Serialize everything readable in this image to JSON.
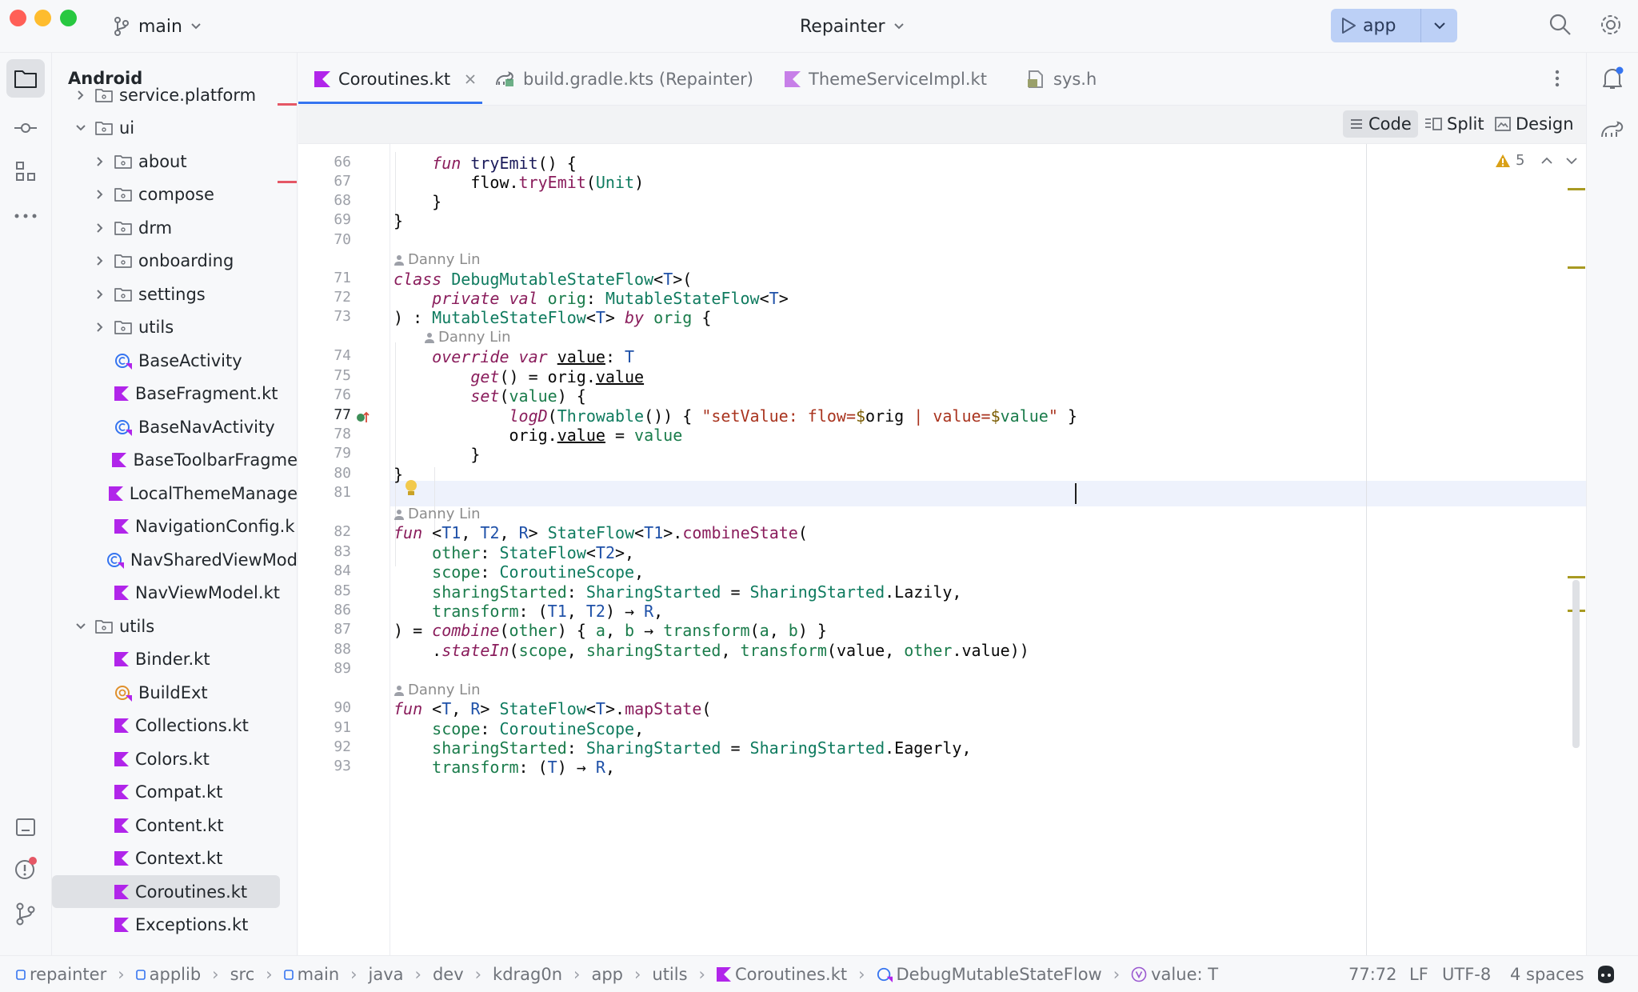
{
  "window": {
    "branch": "main",
    "project": "Repainter",
    "run_config": "app"
  },
  "project_panel": {
    "title": "Android",
    "tree": [
      {
        "label": "service.platform",
        "type": "folder",
        "depth": 1,
        "expanded": false,
        "clipped": true
      },
      {
        "label": "ui",
        "type": "folder",
        "depth": 1,
        "expanded": true
      },
      {
        "label": "about",
        "type": "folder",
        "depth": 2,
        "expanded": false
      },
      {
        "label": "compose",
        "type": "folder",
        "depth": 2,
        "expanded": false
      },
      {
        "label": "drm",
        "type": "folder",
        "depth": 2,
        "expanded": false
      },
      {
        "label": "onboarding",
        "type": "folder",
        "depth": 2,
        "expanded": false
      },
      {
        "label": "settings",
        "type": "folder",
        "depth": 2,
        "expanded": false
      },
      {
        "label": "utils",
        "type": "folder",
        "depth": 2,
        "expanded": false
      },
      {
        "label": "BaseActivity",
        "type": "class",
        "depth": 2
      },
      {
        "label": "BaseFragment.kt",
        "type": "kotlin",
        "depth": 2
      },
      {
        "label": "BaseNavActivity",
        "type": "class",
        "depth": 2
      },
      {
        "label": "BaseToolbarFragme",
        "type": "kotlin",
        "depth": 2
      },
      {
        "label": "LocalThemeManage",
        "type": "kotlin",
        "depth": 2
      },
      {
        "label": "NavigationConfig.k",
        "type": "kotlin",
        "depth": 2
      },
      {
        "label": "NavSharedViewMod",
        "type": "class",
        "depth": 2
      },
      {
        "label": "NavViewModel.kt",
        "type": "kotlin",
        "depth": 2
      },
      {
        "label": "utils",
        "type": "folder",
        "depth": 1,
        "expanded": true
      },
      {
        "label": "Binder.kt",
        "type": "kotlin",
        "depth": 2
      },
      {
        "label": "BuildExt",
        "type": "object",
        "depth": 2
      },
      {
        "label": "Collections.kt",
        "type": "kotlin",
        "depth": 2
      },
      {
        "label": "Colors.kt",
        "type": "kotlin",
        "depth": 2
      },
      {
        "label": "Compat.kt",
        "type": "kotlin",
        "depth": 2
      },
      {
        "label": "Content.kt",
        "type": "kotlin",
        "depth": 2
      },
      {
        "label": "Context.kt",
        "type": "kotlin",
        "depth": 2
      },
      {
        "label": "Coroutines.kt",
        "type": "kotlin",
        "depth": 2,
        "selected": true
      },
      {
        "label": "Exceptions.kt",
        "type": "kotlin",
        "depth": 2
      }
    ]
  },
  "tabs": [
    {
      "label": "Coroutines.kt",
      "type": "kotlin",
      "active": true,
      "closable": true
    },
    {
      "label": "build.gradle.kts (Repainter)",
      "type": "gradle",
      "active": false
    },
    {
      "label": "ThemeServiceImpl.kt",
      "type": "kotlin",
      "active": false
    },
    {
      "label": "sys.h",
      "type": "header",
      "active": false
    }
  ],
  "view_modes": {
    "code": "Code",
    "split": "Split",
    "design": "Design"
  },
  "inspections": {
    "warnings": "5"
  },
  "editor": {
    "current_line": "77",
    "author": "Danny Lin",
    "lines": [
      {
        "n": "66",
        "text": "    fun tryEmit() {"
      },
      {
        "n": "67",
        "text": "        flow.tryEmit(Unit)"
      },
      {
        "n": "68",
        "text": "    }"
      },
      {
        "n": "69",
        "text": "}"
      },
      {
        "n": "70",
        "text": ""
      },
      {
        "n": "71",
        "text": "class DebugMutableStateFlow<T>("
      },
      {
        "n": "72",
        "text": "    private val orig: MutableStateFlow<T>"
      },
      {
        "n": "73",
        "text": ") : MutableStateFlow<T> by orig {"
      },
      {
        "n": "74",
        "text": "    override var value: T"
      },
      {
        "n": "75",
        "text": "        get() = orig.value"
      },
      {
        "n": "76",
        "text": "        set(value) {"
      },
      {
        "n": "77",
        "text": "            logD(Throwable()) { \"setValue: flow=$orig | value=$value\" }"
      },
      {
        "n": "78",
        "text": "            orig.value = value"
      },
      {
        "n": "79",
        "text": "        }"
      },
      {
        "n": "80",
        "text": "}"
      },
      {
        "n": "81",
        "text": ""
      },
      {
        "n": "82",
        "text": "fun <T1, T2, R> StateFlow<T1>.combineState("
      },
      {
        "n": "83",
        "text": "    other: StateFlow<T2>,"
      },
      {
        "n": "84",
        "text": "    scope: CoroutineScope,"
      },
      {
        "n": "85",
        "text": "    sharingStarted: SharingStarted = SharingStarted.Lazily,"
      },
      {
        "n": "86",
        "text": "    transform: (T1, T2) → R,"
      },
      {
        "n": "87",
        "text": ") = combine(other) { a, b → transform(a, b) }"
      },
      {
        "n": "88",
        "text": "    .stateIn(scope, sharingStarted, transform(value, other.value))"
      },
      {
        "n": "89",
        "text": ""
      },
      {
        "n": "90",
        "text": "fun <T, R> StateFlow<T>.mapState("
      },
      {
        "n": "91",
        "text": "    scope: CoroutineScope,"
      },
      {
        "n": "92",
        "text": "    sharingStarted: SharingStarted = SharingStarted.Eagerly,"
      },
      {
        "n": "93",
        "text": "    transform: (T) → R,"
      }
    ]
  },
  "breadcrumbs": [
    "repainter",
    "applib",
    "src",
    "main",
    "java",
    "dev",
    "kdrag0n",
    "app",
    "utils",
    "Coroutines.kt",
    "DebugMutableStateFlow",
    "value: T"
  ],
  "status": {
    "position": "77:72",
    "line_ending": "LF",
    "encoding": "UTF-8",
    "indent": "4 spaces"
  },
  "colors": {
    "accent": "#3574f0",
    "kotlin_icon": "#b125ea",
    "run_button": "#bcd0f6",
    "current_line": "#eef2fc"
  }
}
